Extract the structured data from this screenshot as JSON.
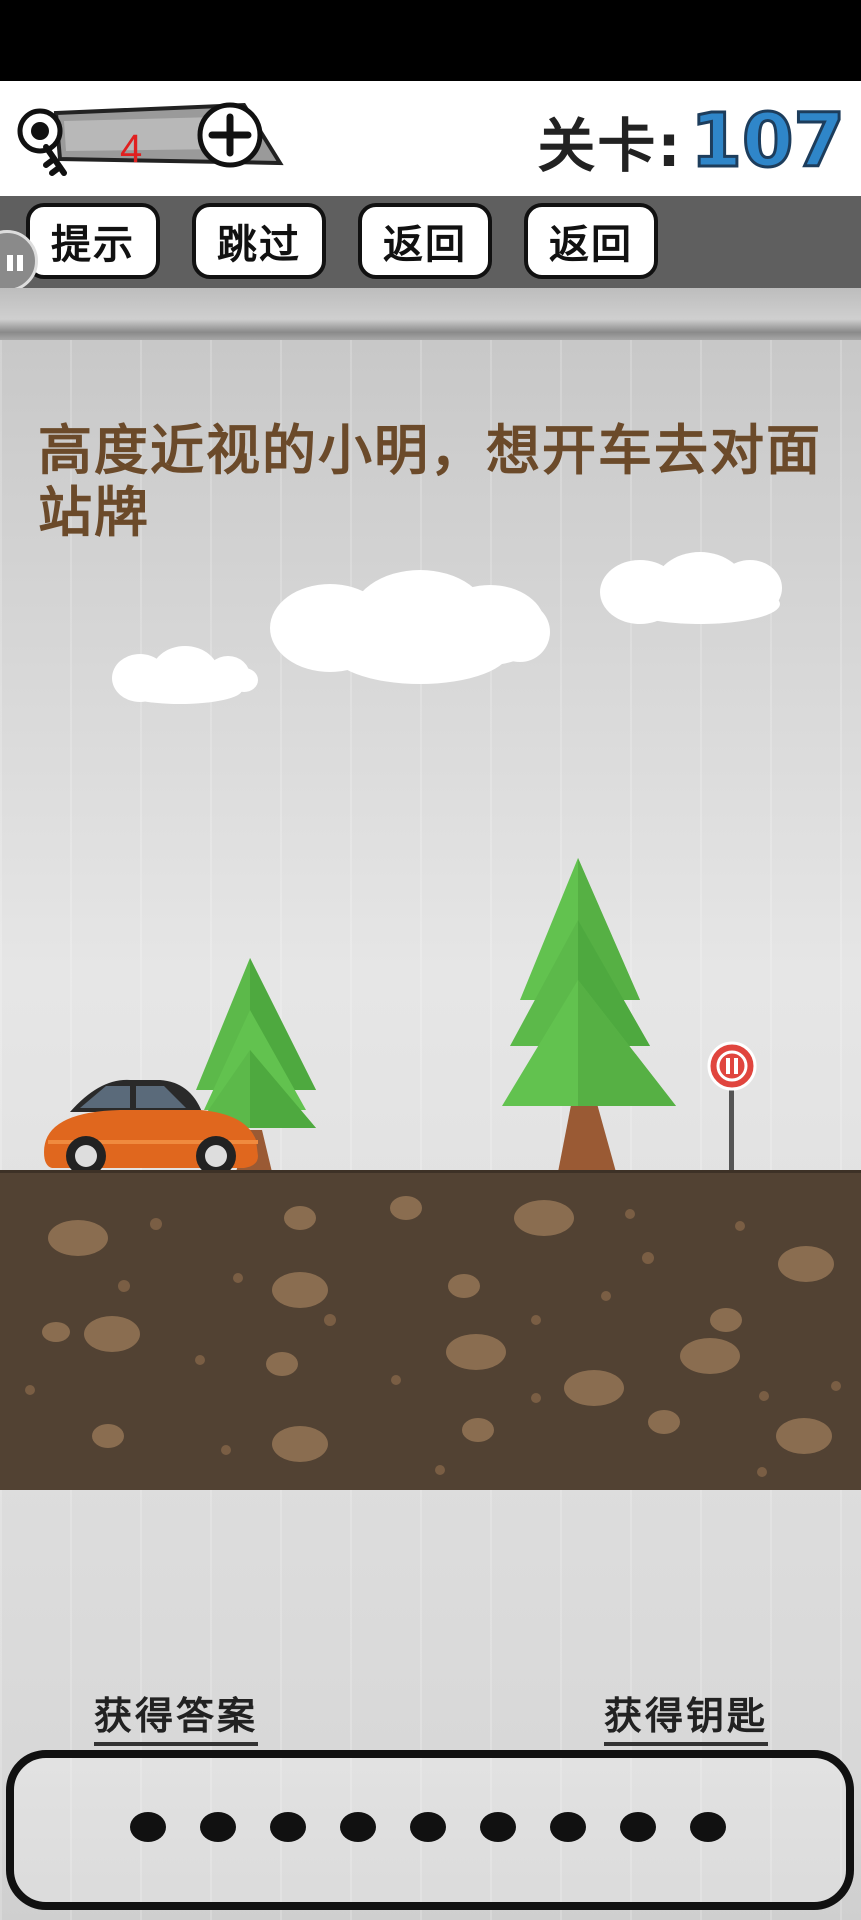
{
  "header": {
    "key_count": "4",
    "level_label": "关卡:",
    "level_number": "107"
  },
  "toolbar": {
    "buttons": [
      {
        "label": "提示"
      },
      {
        "label": "跳过"
      },
      {
        "label": "返回"
      },
      {
        "label": "返回"
      }
    ]
  },
  "puzzle": {
    "question": "高度近视的小明，想开车去对面站牌"
  },
  "footer": {
    "get_answer": "获得答案",
    "get_key": "获得钥匙",
    "answer_slots": 9
  },
  "colors": {
    "car": "#e0671e",
    "tree": "#5cb94a",
    "ground": "#524233",
    "sign": "#e0453e",
    "level_number": "#2f86c9"
  }
}
